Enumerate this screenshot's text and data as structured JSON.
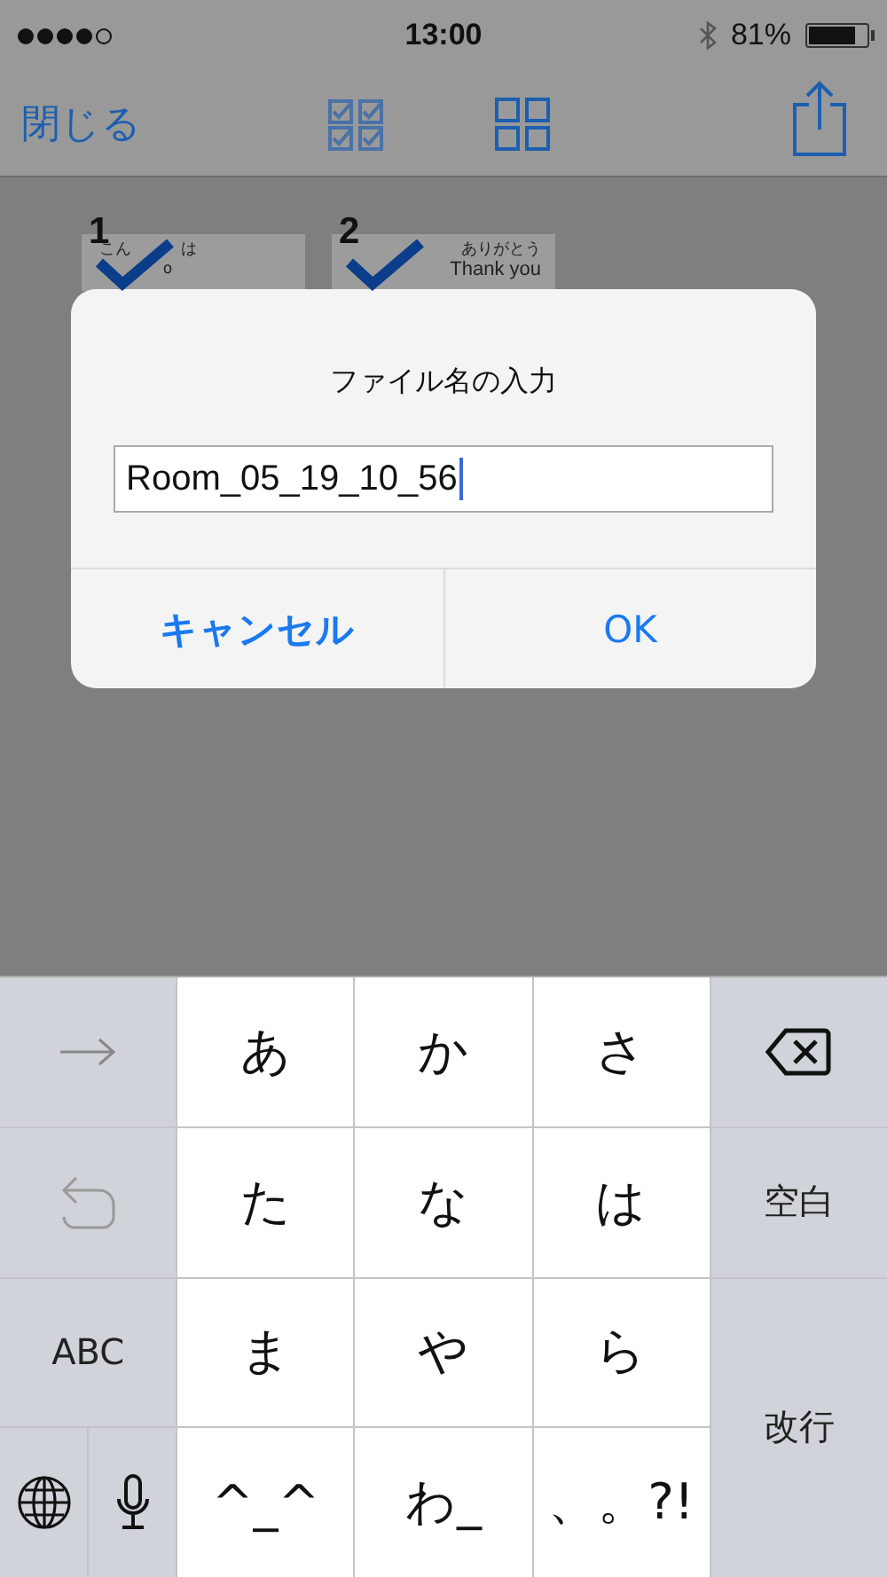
{
  "status_bar": {
    "signal_dots": [
      {
        "filled": true
      },
      {
        "filled": true
      },
      {
        "filled": true
      },
      {
        "filled": true
      },
      {
        "filled": false
      }
    ],
    "time": "13:00",
    "battery_percent": "81%",
    "battery": {
      "level": 0.81
    }
  },
  "nav_bar": {
    "close": "閉じる"
  },
  "thumbnails": [
    {
      "number": "1",
      "checked": true,
      "lines": [
        "こん",
        "は",
        "o"
      ]
    },
    {
      "number": "2",
      "checked": true,
      "lines": [
        "ありがとう",
        "Thank you"
      ]
    }
  ],
  "dialog": {
    "title": "ファイル名の入力",
    "field": {
      "value": "Room_05_19_10_56"
    },
    "buttons": [
      {
        "label": "キャンセル",
        "kind": "cancel"
      },
      {
        "label": "OK",
        "kind": "default"
      }
    ]
  },
  "keyboard": {
    "rows": [
      [
        {
          "kind": "next"
        },
        {
          "kind": "char",
          "label": "あ"
        },
        {
          "kind": "char",
          "label": "か"
        },
        {
          "kind": "char",
          "label": "さ"
        },
        {
          "kind": "delete"
        }
      ],
      [
        {
          "kind": "undo"
        },
        {
          "kind": "char",
          "label": "た"
        },
        {
          "kind": "char",
          "label": "な"
        },
        {
          "kind": "char",
          "label": "は"
        },
        {
          "kind": "func",
          "label": "空白"
        }
      ],
      [
        {
          "kind": "func",
          "label": "ABC"
        },
        {
          "kind": "char",
          "label": "ま"
        },
        {
          "kind": "char",
          "label": "や"
        },
        {
          "kind": "char",
          "label": "ら"
        },
        {
          "kind": "return",
          "label": "改行"
        }
      ],
      [
        {
          "kind": "split",
          "keys": [
            {
              "kind": "globe"
            },
            {
              "kind": "mic"
            }
          ]
        },
        {
          "kind": "char",
          "label": "^_^"
        },
        {
          "kind": "char",
          "label": "わ_"
        },
        {
          "kind": "char",
          "label": "、。?!"
        }
      ]
    ]
  }
}
